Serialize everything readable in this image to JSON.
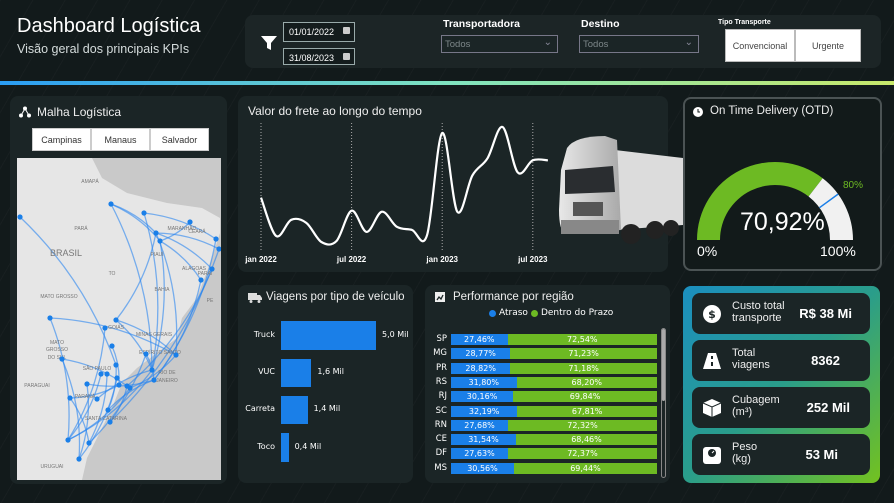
{
  "header": {
    "title": "Dashboard Logística",
    "subtitle": "Visão geral dos principais KPIs"
  },
  "filters": {
    "date_start": "01/01/2022",
    "date_end": "31/08/2023",
    "transportadora_label": "Transportadora",
    "transportadora_value": "Todos",
    "destino_label": "Destino",
    "destino_value": "Todos",
    "tipo_label": "Tipo Transporte",
    "tipo_options": [
      "Convencional",
      "Urgente"
    ]
  },
  "map": {
    "title": "Malha Logística",
    "buttons": [
      "Campinas",
      "Manaus",
      "Salvador"
    ],
    "labels": [
      "AMAPÁ",
      "PARÁ",
      "MARANHÃO",
      "CEARÁ",
      "PARAÍ",
      "PIAUÍ",
      "PE",
      "ALAGOAS",
      "BRASIL",
      "TO",
      "BAHIA",
      "MATO GROSSO",
      "GOIÁS",
      "MINAS GERAIS",
      "MATO",
      "GROSSO",
      "DO SUL",
      "ESPÍRITO SANTO",
      "SÃO PAULO",
      "RIO DE",
      "JANEIRO",
      "PARAGUAI",
      "PARANÁ",
      "SANTA CATARINA",
      "URUGUAI"
    ],
    "route_color": "#2a86f0"
  },
  "freight": {
    "title": "Valor do frete ao longo do tempo"
  },
  "otd": {
    "title": "On Time Delivery (OTD)",
    "value_label": "70,92%",
    "min_label": "0%",
    "max_label": "100%",
    "target_label": "80%"
  },
  "vehicles": {
    "title": "Viagens por tipo de veículo"
  },
  "performance": {
    "title": "Performance por região"
  },
  "kpis": [
    {
      "icon": "dollar-icon",
      "label1": "Custo total",
      "label2": "transporte",
      "value": "R$ 38 Mi"
    },
    {
      "icon": "road-icon",
      "label1": "Total",
      "label2": "viagens",
      "value": "8362"
    },
    {
      "icon": "box-icon",
      "label1": "Cubagem",
      "label2": "(m³)",
      "value": "252 Mil"
    },
    {
      "icon": "scale-icon",
      "label1": "Peso",
      "label2": "(kg)",
      "value": "53 Mi"
    }
  ],
  "colors": {
    "atraso": "#1a7fe8",
    "prazo": "#6dba23",
    "accent_gradient": [
      "#2a9df4",
      "#7fe3a0",
      "#c8e86a"
    ]
  },
  "chart_data": [
    {
      "type": "line",
      "title": "Valor do frete ao longo do tempo",
      "x": [
        "jan 2022",
        "fev 2022",
        "mar 2022",
        "abr 2022",
        "mai 2022",
        "jun 2022",
        "jul 2022",
        "ago 2022",
        "set 2022",
        "out 2022",
        "nov 2022",
        "dez 2022",
        "jan 2023",
        "fev 2023",
        "mar 2023",
        "abr 2023",
        "mai 2023",
        "jun 2023",
        "jul 2023",
        "ago 2023"
      ],
      "values": [
        51,
        13,
        29,
        26,
        7,
        8,
        38,
        17,
        37,
        22,
        19,
        14,
        115,
        37,
        73,
        90,
        121,
        76,
        88,
        88
      ],
      "xticks": [
        "jan 2022",
        "jul 2022",
        "jan 2023",
        "jul 2023"
      ],
      "grid": "vertical-dotted"
    },
    {
      "type": "bar",
      "orientation": "horizontal",
      "title": "Viagens por tipo de veículo",
      "categories": [
        "Truck",
        "VUC",
        "Carreta",
        "Toco"
      ],
      "values": [
        5.0,
        1.6,
        1.4,
        0.4
      ],
      "data_labels": [
        "5,0 Mil",
        "1,6 Mil",
        "1,4 Mil",
        "0,4 Mil"
      ],
      "unit": "Mil"
    },
    {
      "type": "bar",
      "orientation": "horizontal",
      "stacked": "100%",
      "title": "Performance por região",
      "legend": [
        "Atraso",
        "Dentro do Prazo"
      ],
      "legend_position": "top",
      "categories": [
        "SP",
        "MG",
        "PR",
        "RS",
        "RJ",
        "SC",
        "RN",
        "CE",
        "DF",
        "MS"
      ],
      "series": [
        {
          "name": "Atraso",
          "values": [
            27.46,
            28.77,
            28.82,
            31.8,
            30.16,
            32.19,
            27.68,
            31.54,
            27.63,
            30.56
          ],
          "labels": [
            "27,46%",
            "28,77%",
            "28,82%",
            "31,80%",
            "30,16%",
            "32,19%",
            "27,68%",
            "31,54%",
            "27,63%",
            "30,56%"
          ]
        },
        {
          "name": "Dentro do Prazo",
          "values": [
            72.54,
            71.23,
            71.18,
            68.2,
            69.84,
            67.81,
            72.32,
            68.46,
            72.37,
            69.44
          ],
          "labels": [
            "72,54%",
            "71,23%",
            "71,18%",
            "68,20%",
            "69,84%",
            "67,81%",
            "72,32%",
            "68,46%",
            "72,37%",
            "69,44%"
          ]
        }
      ]
    },
    {
      "type": "gauge",
      "title": "On Time Delivery (OTD)",
      "value": 70.92,
      "min": 0,
      "max": 100,
      "target": 80
    }
  ]
}
